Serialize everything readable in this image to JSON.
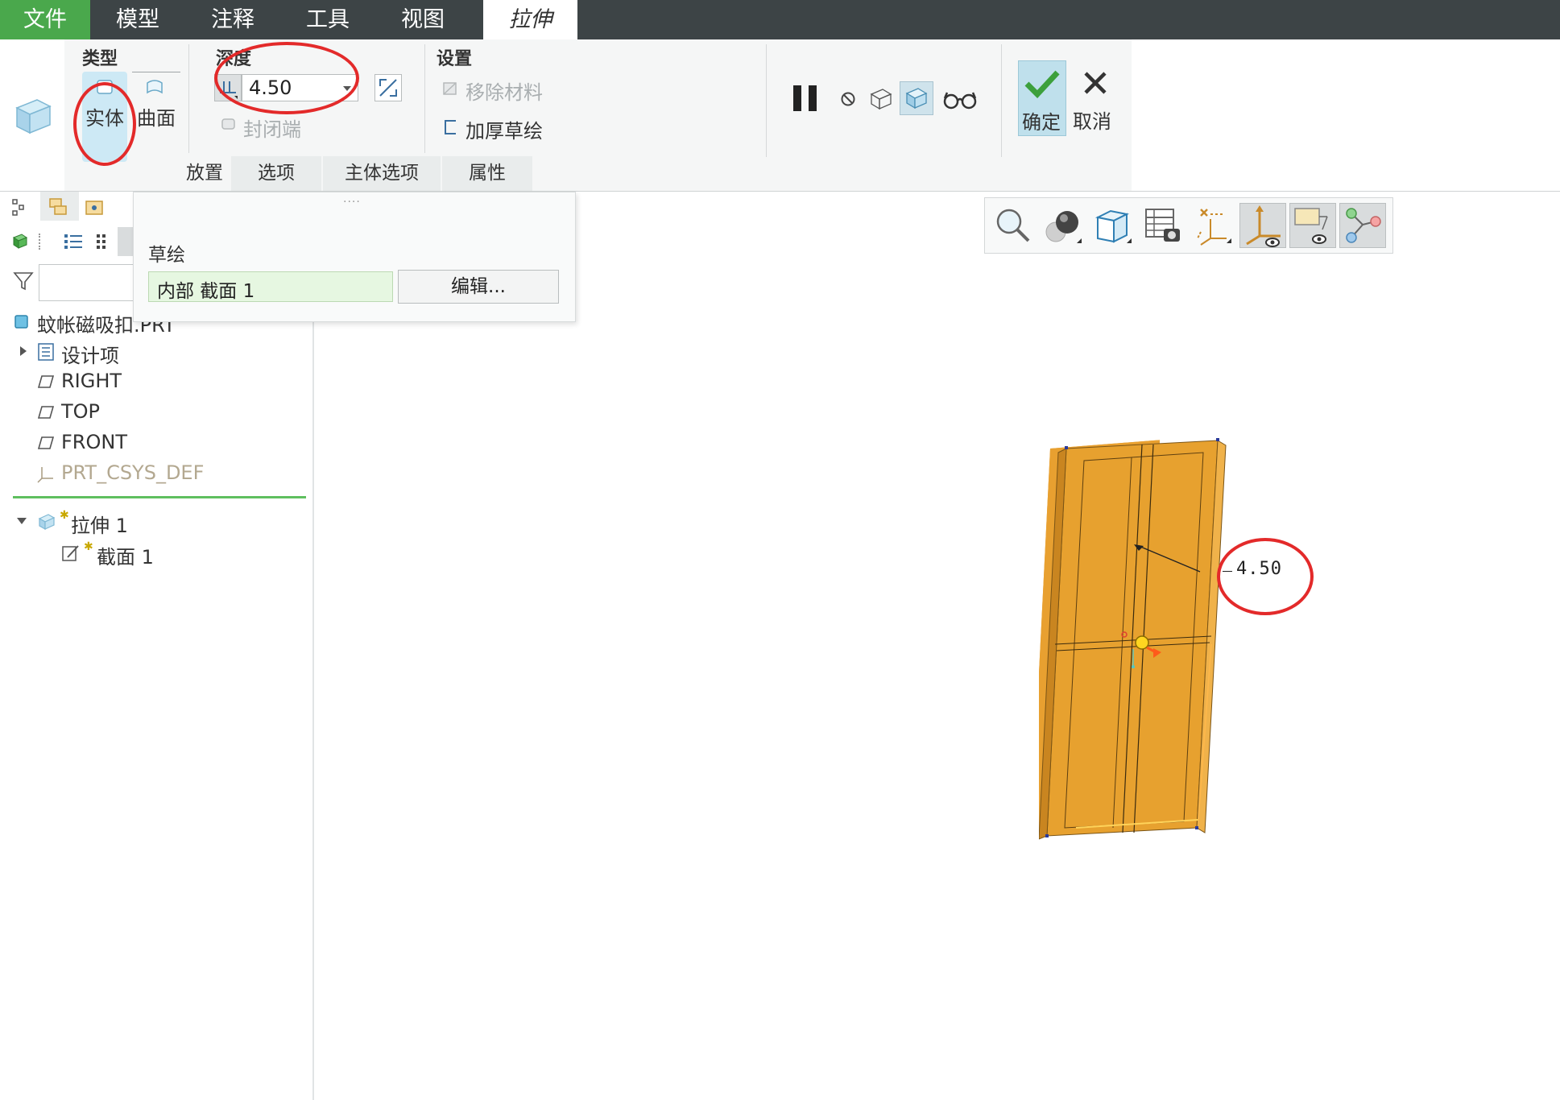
{
  "menu": {
    "file": "文件",
    "model": "模型",
    "annotate": "注释",
    "tools": "工具",
    "view": "视图",
    "extrude": "拉伸"
  },
  "ribbon": {
    "type_label": "类型",
    "solid": "实体",
    "surface": "曲面",
    "depth_label": "深度",
    "depth_value": "4.50",
    "capped_ends": "封闭端",
    "settings_label": "设置",
    "remove_material": "移除材料",
    "thicken_sketch": "加厚草绘",
    "ok": "确定",
    "cancel": "取消",
    "tabs": [
      "放置",
      "选项",
      "主体选项",
      "属性"
    ]
  },
  "placement_panel": {
    "sketch_label": "草绘",
    "sketch_value": "内部 截面 1",
    "edit_button": "编辑..."
  },
  "model_tree": {
    "root": "蚊帐磁吸扣.PRT",
    "items": [
      "设计项",
      "RIGHT",
      "TOP",
      "FRONT",
      "PRT_CSYS_DEF"
    ],
    "feature": "拉伸 1",
    "section": "截面 1"
  },
  "viewport": {
    "dimension": "4.50"
  },
  "colors": {
    "menubar": "#3d4446",
    "file_menu": "#4aa84c",
    "part_fill": "#e8a030",
    "annotation_red": "#e32a2a"
  }
}
